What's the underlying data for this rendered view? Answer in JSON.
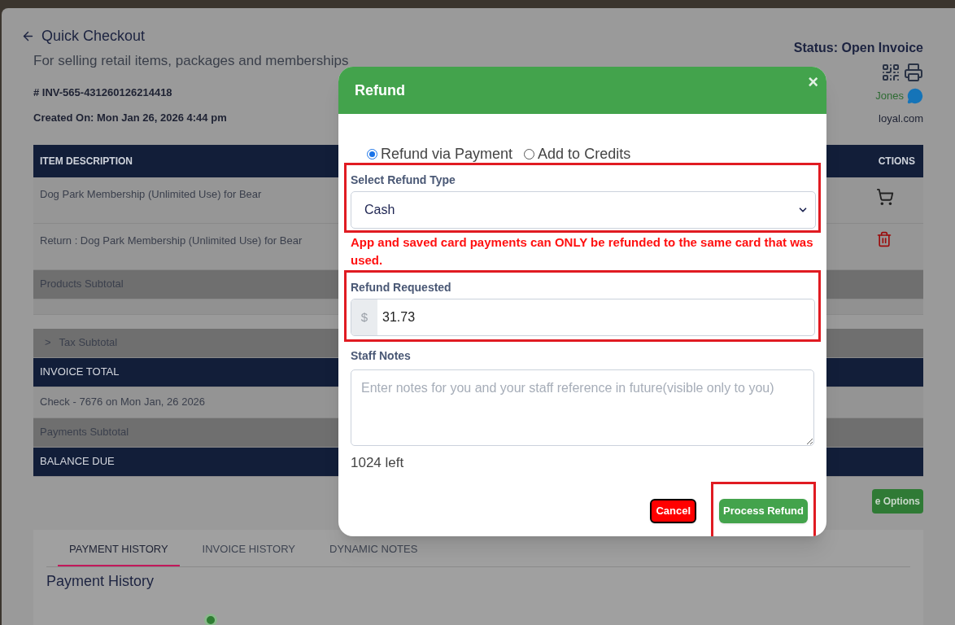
{
  "page": {
    "title": "Quick Checkout",
    "subtitle": "For selling retail items, packages and memberships",
    "invoice_number": "# INV-565-431260126214418",
    "created_on": "Created On: Mon Jan 26, 2026 4:44 pm",
    "status": "Status: Open Invoice",
    "customer_name": "Jones",
    "customer_email": "loyal.com"
  },
  "table": {
    "columns": [
      "ITEM DESCRIPTION",
      "CTIONS"
    ],
    "rows": [
      {
        "kind": "item",
        "description": "Dog Park Membership (Unlimited Use) for Bear"
      },
      {
        "kind": "return",
        "description": "Return : Dog Park Membership (Unlimited Use) for Bear"
      },
      {
        "kind": "subtotal",
        "description": "Products Subtotal"
      },
      {
        "kind": "blank"
      },
      {
        "kind": "expandable",
        "toggle": ">",
        "description": "Tax Subtotal"
      },
      {
        "kind": "total",
        "description": "INVOICE TOTAL"
      },
      {
        "kind": "payment",
        "description": "Check - 7676 on Mon Jan, 26 2026"
      },
      {
        "kind": "subtotal",
        "description": "Payments Subtotal"
      },
      {
        "kind": "total",
        "description": "BALANCE DUE"
      }
    ]
  },
  "options_button": "e Options",
  "tabs": [
    {
      "label": "PAYMENT HISTORY",
      "selected": true
    },
    {
      "label": "INVOICE HISTORY",
      "selected": false
    },
    {
      "label": "DYNAMIC NOTES",
      "selected": false
    }
  ],
  "section_heading": "Payment History",
  "modal": {
    "title": "Refund",
    "close": "×",
    "refund_methods": [
      {
        "label": "Refund via Payment",
        "selected": true
      },
      {
        "label": "Add to Credits",
        "selected": false
      }
    ],
    "refund_type": {
      "label": "Select Refund Type",
      "value": "Cash",
      "highlighted": true
    },
    "warning": "App and saved card payments can ONLY be refunded to the same card that was used.",
    "refund_requested": {
      "label": "Refund Requested",
      "prefix": "$",
      "value": "31.73",
      "highlighted": true
    },
    "staff_notes": {
      "label": "Staff Notes",
      "placeholder": "Enter notes for you and your staff reference in future(visible only to you)"
    },
    "remaining": "1024 left",
    "buttons": [
      {
        "kind": "cancel",
        "label": "Cancel",
        "highlighted": false
      },
      {
        "kind": "primary",
        "label": "Process Refund",
        "highlighted": true
      }
    ]
  }
}
